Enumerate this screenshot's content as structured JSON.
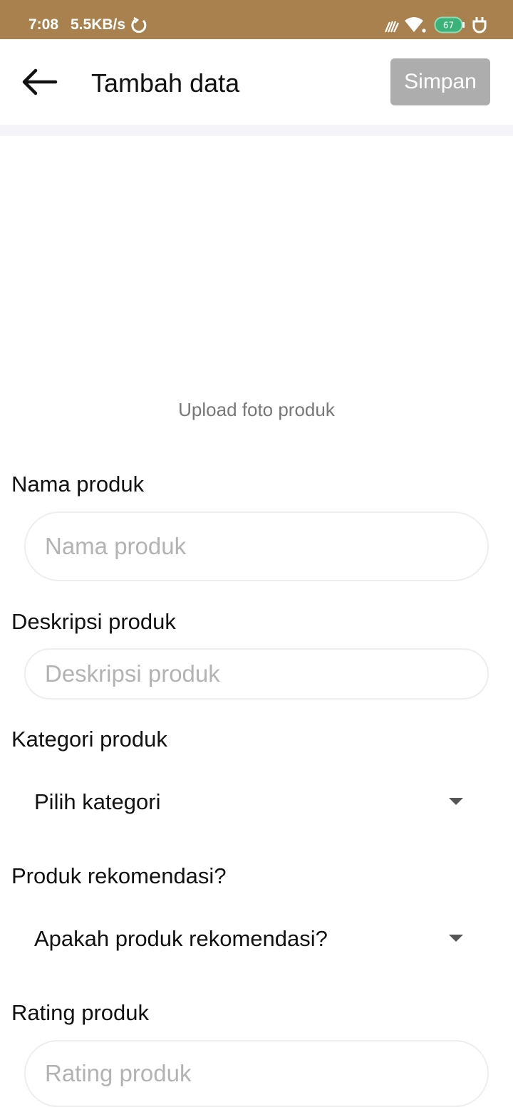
{
  "status_bar": {
    "time": "7:08",
    "network_speed": "5.5KB/s",
    "battery_level": "67",
    "background_color": "#a9814e",
    "icons": [
      "sync-icon",
      "vibrate-icon",
      "wifi-icon",
      "battery-icon",
      "charging-plug-icon"
    ]
  },
  "app_bar": {
    "title": "Tambah data",
    "save_label": "Simpan",
    "save_button_color": "#adadad",
    "back_icon": "back-arrow-icon"
  },
  "photo_upload": {
    "label": "Upload foto produk"
  },
  "form": {
    "name": {
      "label": "Nama produk",
      "value": "",
      "placeholder": "Nama produk"
    },
    "description": {
      "label": "Deskripsi produk",
      "value": "",
      "placeholder": "Deskripsi produk"
    },
    "category": {
      "label": "Kategori produk",
      "selected": "Pilih kategori"
    },
    "recommended": {
      "label": "Produk rekomendasi?",
      "selected": "Apakah produk rekomendasi?"
    },
    "rating": {
      "label": "Rating produk",
      "value": "",
      "placeholder": "Rating produk"
    }
  }
}
